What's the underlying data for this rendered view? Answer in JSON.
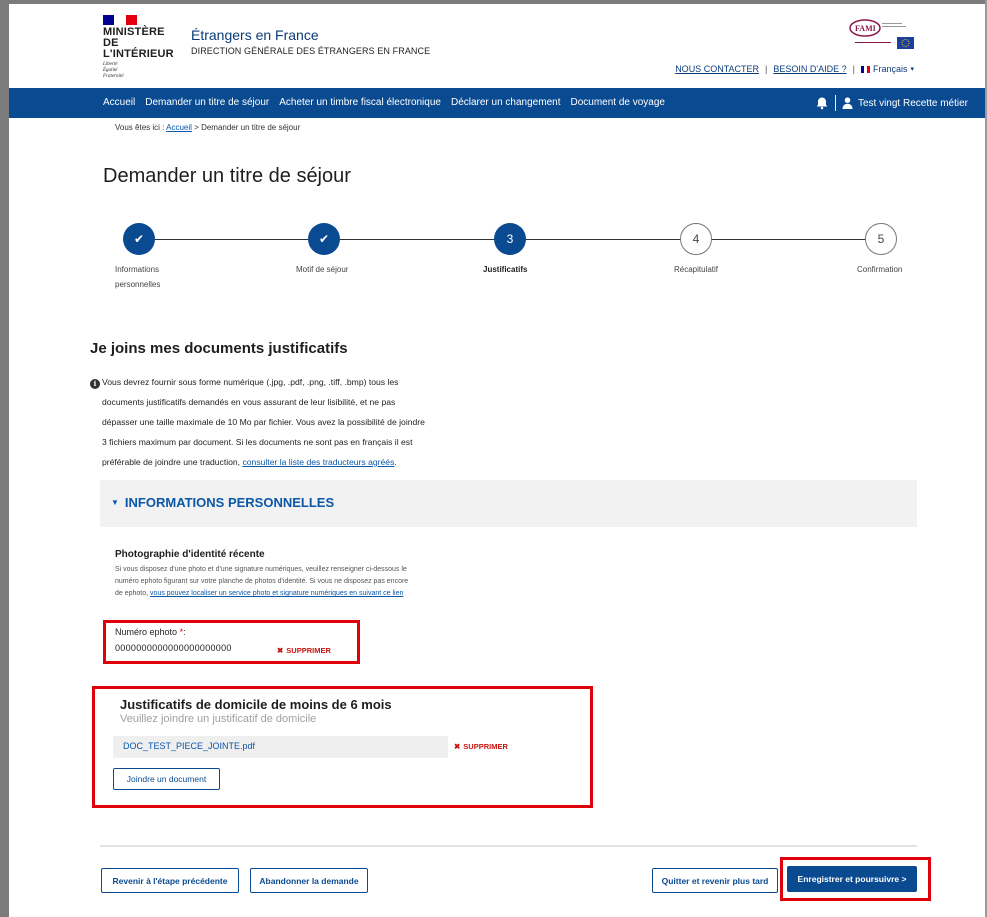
{
  "header": {
    "ministry_lines": [
      "MINISTÈRE",
      "DE L'INTÉRIEUR"
    ],
    "motto_lines": [
      "Liberté",
      "Égalité",
      "Fraternité"
    ],
    "site_title": "Étrangers en France",
    "site_subtitle": "DIRECTION GÉNÉRALE DES ÉTRANGERS EN FRANCE",
    "fami_logo_text": "FAMI",
    "links": {
      "contact": "NOUS CONTACTER",
      "help": "BESOIN D'AIDE ?",
      "language": "Français"
    }
  },
  "nav": {
    "items": [
      "Accueil",
      "Demander un titre de séjour",
      "Acheter un timbre fiscal électronique",
      "Déclarer un changement",
      "Document de voyage"
    ],
    "user_name": "Test vingt Recette métier"
  },
  "breadcrumb": {
    "prefix": "Vous êtes ici :",
    "home": "Accueil",
    "current": "> Demander un titre de séjour"
  },
  "page_title": "Demander un titre de séjour",
  "stepper": {
    "steps": [
      {
        "marker": "✔",
        "label": "Informations personnelles",
        "state": "done"
      },
      {
        "marker": "✔",
        "label": "Motif de séjour",
        "state": "done"
      },
      {
        "marker": "3",
        "label": "Justificatifs",
        "state": "current"
      },
      {
        "marker": "4",
        "label": "Récapitulatif",
        "state": "todo"
      },
      {
        "marker": "5",
        "label": "Confirmation",
        "state": "todo"
      }
    ]
  },
  "docs": {
    "title": "Je joins mes documents justificatifs",
    "info_lines": [
      "Vous devrez fournir sous forme numérique (.jpg, .pdf, .png, .tiff, .bmp) tous les",
      "documents justificatifs demandés en vous assurant de leur lisibilité, et ne pas",
      "dépasser une taille maximale de 10 Mo par fichier. Vous avez la possibilité de joindre",
      "3 fichiers maximum par document. Si les documents ne sont pas en français il est",
      "préférable de joindre une traduction,"
    ],
    "translators_link": "consulter la liste des traducteurs agréés",
    "translators_suffix": "."
  },
  "accordion": {
    "title": "INFORMATIONS PERSONNELLES"
  },
  "photo": {
    "title": "Photographie d'identité récente",
    "desc": "Si vous disposez d'une photo et d'une signature numériques, veuillez renseigner ci-dessous le numéro ephoto figurant sur votre planche de photos d'identité. Si vous ne disposez pas encore de ephoto,",
    "desc_link": "vous pouvez localiser un service photo et signature numériques en suivant ce lien",
    "ephoto_label": "Numéro ephoto",
    "required_mark": "*",
    "ephoto_colon": ":",
    "ephoto_value": "0000000000000000000000",
    "delete": "SUPPRIMER"
  },
  "domicile": {
    "title": "Justificatifs de domicile de moins de 6 mois",
    "subtitle": "Veuillez joindre un justificatif de domicile",
    "file_name": "DOC_TEST_PIECE_JOINTE.pdf",
    "delete": "SUPPRIMER",
    "attach_button": "Joindre un document"
  },
  "footer_buttons": {
    "previous": "Revenir à l'étape précédente",
    "abandon": "Abandonner la demande",
    "quit": "Quitter et revenir plus tard",
    "save": "Enregistrer et poursuivre >"
  },
  "colors": {
    "brand_blue": "#0a4a91",
    "link_blue": "#0b57a8",
    "highlight_red": "#e0000a",
    "delete_red": "#c8140e"
  }
}
